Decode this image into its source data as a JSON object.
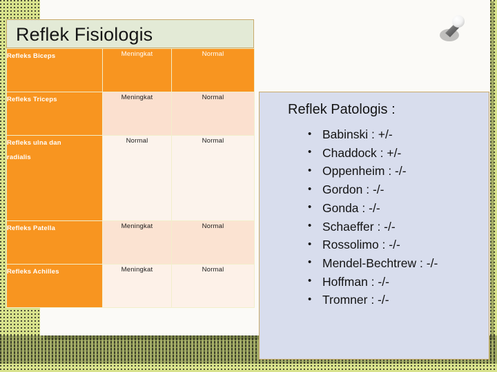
{
  "slide": {
    "title": "Reflek Fisiologis"
  },
  "table": {
    "rows": [
      {
        "label": "Refleks Biceps",
        "col2": "Meningkat",
        "col3": "Normal"
      },
      {
        "label": "Refleks Triceps",
        "col2": "Meningkat",
        "col3": "Normal"
      },
      {
        "label": "Refleks ulna dan radialis",
        "col2": "Normal",
        "col3": "Normal"
      },
      {
        "label": "Refleks Patella",
        "col2": "Meningkat",
        "col3": "Normal"
      },
      {
        "label": "Refleks Achilles",
        "col2": "Meningkat",
        "col3": "Normal"
      }
    ]
  },
  "patologis": {
    "heading": "Reflek Patologis :",
    "items": [
      "Babinski : +/-",
      "Chaddock : +/-",
      "Oppenheim : -/-",
      "Gordon : -/-",
      "Gonda : -/-",
      "Schaeffer : -/-",
      "Rossolimo : -/-",
      "Mendel-Bechtrew : -/-",
      "Hoffman : -/-",
      "Tromner : -/-"
    ]
  },
  "decor": {
    "pushpin": "pushpin-icon"
  },
  "colors": {
    "background": "#d8e28c",
    "slide": "#fbfaf7",
    "title_box": "#e3ead6",
    "table_accent": "#f89520",
    "panel": "#d8dded",
    "border": "#c8a96a"
  }
}
